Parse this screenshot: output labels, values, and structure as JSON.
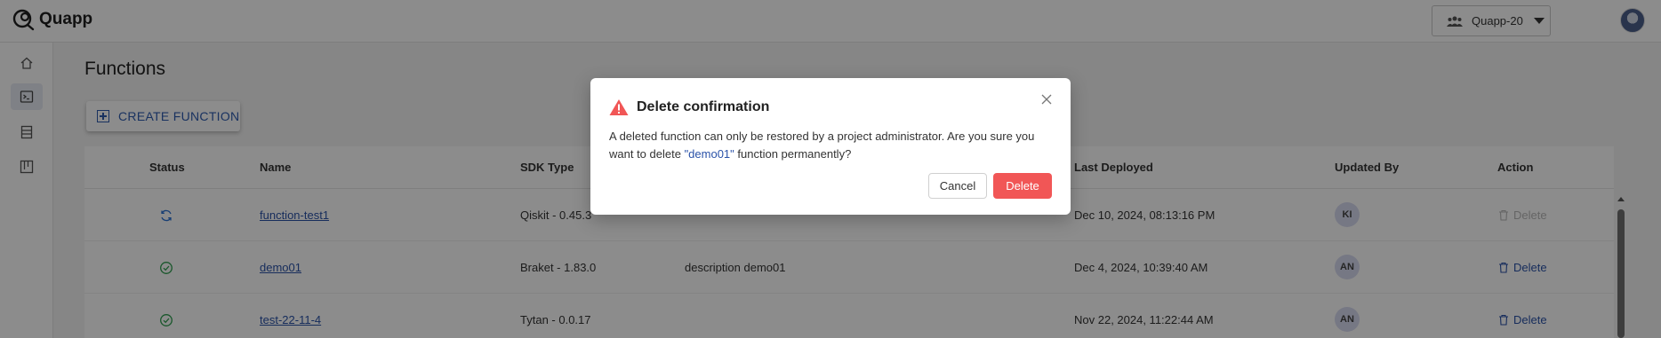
{
  "app": {
    "name": "Quapp",
    "logo_icon": "quapp-logo-icon"
  },
  "header": {
    "project_selector": {
      "value": "Quapp-20",
      "icon": "users-icon",
      "caret_icon": "caret-down-icon"
    },
    "avatar_icon": "user-avatar"
  },
  "sidebar": {
    "items": [
      {
        "icon": "home-icon",
        "active": false
      },
      {
        "icon": "terminal-icon",
        "active": true
      },
      {
        "icon": "list-icon",
        "active": false
      },
      {
        "icon": "board-icon",
        "active": false
      }
    ]
  },
  "page": {
    "title": "Functions",
    "create_button": "CREATE FUNCTION"
  },
  "table": {
    "columns": {
      "status": "Status",
      "name": "Name",
      "sdk_type": "SDK Type",
      "last_deployed": "Last Deployed",
      "updated_by": "Updated By",
      "action": "Action"
    },
    "rows": [
      {
        "status": "syncing",
        "status_icon": "sync-icon",
        "name": "function-test1",
        "sdk_type": "Qiskit - 0.45.3",
        "description": "",
        "last_deployed": "Dec 10, 2024, 08:13:16 PM",
        "updated_by": "KI",
        "action": "Delete",
        "action_enabled": false
      },
      {
        "status": "deployed",
        "status_icon": "check-circle-icon",
        "name": "demo01",
        "sdk_type": "Braket - 1.83.0",
        "description": "description demo01",
        "last_deployed": "Dec 4, 2024, 10:39:40 AM",
        "updated_by": "AN",
        "action": "Delete",
        "action_enabled": true
      },
      {
        "status": "deployed",
        "status_icon": "check-circle-icon",
        "name": "test-22-11-4",
        "sdk_type": "Tytan - 0.0.17",
        "description": "",
        "last_deployed": "Nov 22, 2024, 11:22:44 AM",
        "updated_by": "AN",
        "action": "Delete",
        "action_enabled": true
      }
    ]
  },
  "modal": {
    "title": "Delete confirmation",
    "body_before": "A deleted function can only be restored by a project administrator. Are you sure you want to delete ",
    "body_highlight": "\"demo01\"",
    "body_after": " function permanently?",
    "cancel_label": "Cancel",
    "delete_label": "Delete",
    "warning_icon": "warning-icon",
    "close_icon": "close-icon",
    "colors": {
      "danger": "#f15656",
      "link": "#2a52a8"
    }
  }
}
